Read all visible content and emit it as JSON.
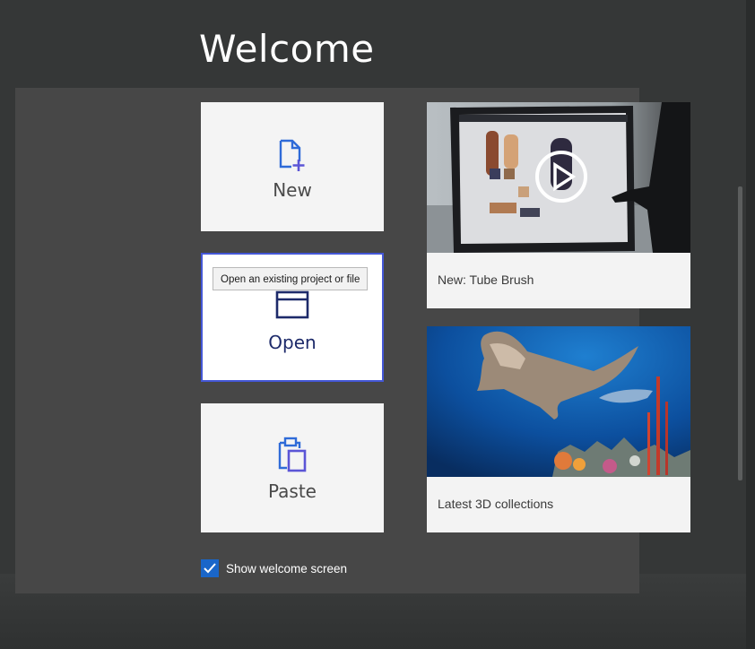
{
  "welcome": {
    "title": "Welcome"
  },
  "tiles": {
    "new": {
      "label": "New",
      "icon": "new-file-icon"
    },
    "open": {
      "label": "Open",
      "icon": "open-folder-icon",
      "tooltip": "Open an existing project or file"
    },
    "paste": {
      "label": "Paste",
      "icon": "paste-clipboard-icon"
    }
  },
  "cards": {
    "video": {
      "caption": "New: Tube Brush",
      "icon": "play-icon"
    },
    "collections": {
      "caption": "Latest 3D collections"
    }
  },
  "footer": {
    "show_welcome_label": "Show welcome screen",
    "show_welcome_checked": true
  },
  "colors": {
    "accent": "#1a66c9",
    "focus_border": "#4457d6",
    "icon_blue": "#2f6bd8",
    "icon_purple": "#5b55d6"
  }
}
